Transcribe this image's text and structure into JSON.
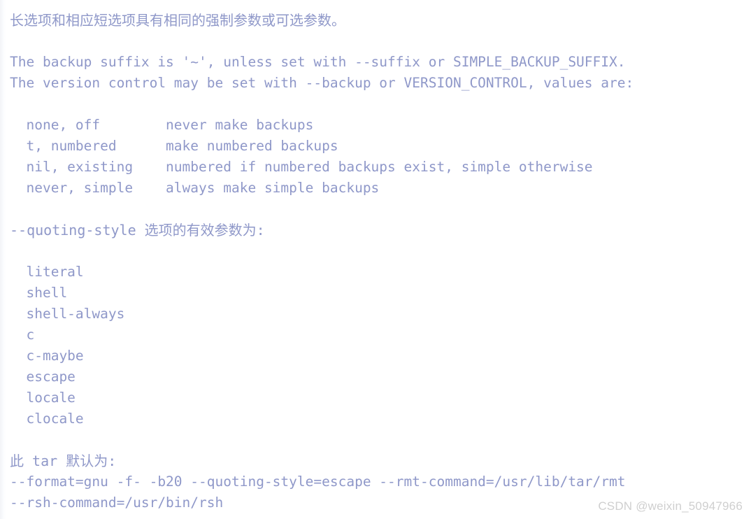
{
  "page": {
    "kind": "terminal-output",
    "command_context": "tar --help",
    "text_color": "#8f98c9",
    "background_color": "#ffffff"
  },
  "lines": [
    {
      "id": "l01",
      "text": "长选项和相应短选项具有相同的强制参数或可选参数。",
      "cjk": true
    },
    {
      "id": "l02",
      "text": "",
      "cjk": false
    },
    {
      "id": "l03",
      "text": "The backup suffix is '~', unless set with --suffix or SIMPLE_BACKUP_SUFFIX.",
      "cjk": false
    },
    {
      "id": "l04",
      "text": "The version control may be set with --backup or VERSION_CONTROL, values are:",
      "cjk": false
    },
    {
      "id": "l05",
      "text": "",
      "cjk": false
    },
    {
      "id": "l06",
      "text": "  none, off        never make backups",
      "cjk": false
    },
    {
      "id": "l07",
      "text": "  t, numbered      make numbered backups",
      "cjk": false
    },
    {
      "id": "l08",
      "text": "  nil, existing    numbered if numbered backups exist, simple otherwise",
      "cjk": false
    },
    {
      "id": "l09",
      "text": "  never, simple    always make simple backups",
      "cjk": false
    },
    {
      "id": "l10",
      "text": "",
      "cjk": false
    },
    {
      "id": "l11",
      "text": "--quoting-style 选项的有效参数为:",
      "cjk": true
    },
    {
      "id": "l12",
      "text": "",
      "cjk": false
    },
    {
      "id": "l13",
      "text": "  literal",
      "cjk": false
    },
    {
      "id": "l14",
      "text": "  shell",
      "cjk": false
    },
    {
      "id": "l15",
      "text": "  shell-always",
      "cjk": false
    },
    {
      "id": "l16",
      "text": "  c",
      "cjk": false
    },
    {
      "id": "l17",
      "text": "  c-maybe",
      "cjk": false
    },
    {
      "id": "l18",
      "text": "  escape",
      "cjk": false
    },
    {
      "id": "l19",
      "text": "  locale",
      "cjk": false
    },
    {
      "id": "l20",
      "text": "  clocale",
      "cjk": false
    },
    {
      "id": "l21",
      "text": "",
      "cjk": false
    },
    {
      "id": "l22",
      "text": "此 tar 默认为:",
      "cjk": true
    },
    {
      "id": "l23",
      "text": "--format=gnu -f- -b20 --quoting-style=escape --rmt-command=/usr/lib/tar/rmt",
      "cjk": false
    },
    {
      "id": "l24",
      "text": "--rsh-command=/usr/bin/rsh",
      "cjk": false
    }
  ],
  "backup_values": {
    "headers": [
      "value",
      "description"
    ],
    "rows": [
      {
        "value": "none, off",
        "description": "never make backups"
      },
      {
        "value": "t, numbered",
        "description": "make numbered backups"
      },
      {
        "value": "nil, existing",
        "description": "numbered if numbered backups exist, simple otherwise"
      },
      {
        "value": "never, simple",
        "description": "always make simple backups"
      }
    ]
  },
  "quoting_styles": [
    "literal",
    "shell",
    "shell-always",
    "c",
    "c-maybe",
    "escape",
    "locale",
    "clocale"
  ],
  "defaults": {
    "intro": "此 tar 默认为:",
    "flags": [
      "--format=gnu",
      "-f-",
      "-b20",
      "--quoting-style=escape",
      "--rmt-command=/usr/lib/tar/rmt",
      "--rsh-command=/usr/bin/rsh"
    ]
  },
  "watermark": {
    "text": "CSDN @weixin_50947966",
    "color": "#cfcfcf"
  }
}
